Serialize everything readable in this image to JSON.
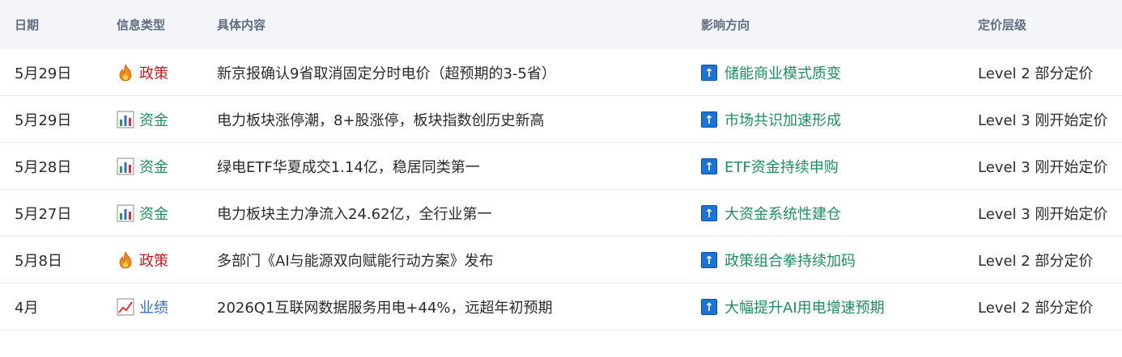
{
  "headers": {
    "date": "日期",
    "type": "信息类型",
    "content": "具体内容",
    "impact": "影响方向",
    "level": "定价层级"
  },
  "colors": {
    "policy": "#c8191c",
    "capital": "#1d8f5f",
    "earnings": "#2f6fd0",
    "impact": "#1d8f5f",
    "arrow": "#1a74d8"
  },
  "rows": [
    {
      "date": "5月29日",
      "type_icon": "fire-icon",
      "type": "政策",
      "content": "新京报确认9省取消固定分时电价（超预期的3-5省）",
      "impact_icon": "up-arrow-icon",
      "impact": "储能商业模式质变",
      "level": "Level 2 部分定价"
    },
    {
      "date": "5月29日",
      "type_icon": "bar-chart-icon",
      "type": "资金",
      "content": "电力板块涨停潮，8+股涨停，板块指数创历史新高",
      "impact_icon": "up-arrow-icon",
      "impact": "市场共识加速形成",
      "level": "Level 3 刚开始定价"
    },
    {
      "date": "5月28日",
      "type_icon": "bar-chart-icon",
      "type": "资金",
      "content": "绿电ETF华夏成交1.14亿，稳居同类第一",
      "impact_icon": "up-arrow-icon",
      "impact": "ETF资金持续申购",
      "level": "Level 3 刚开始定价"
    },
    {
      "date": "5月27日",
      "type_icon": "bar-chart-icon",
      "type": "资金",
      "content": "电力板块主力净流入24.62亿，全行业第一",
      "impact_icon": "up-arrow-icon",
      "impact": "大资金系统性建仓",
      "level": "Level 3 刚开始定价"
    },
    {
      "date": "5月8日",
      "type_icon": "fire-icon",
      "type": "政策",
      "content": "多部门《AI与能源双向赋能行动方案》发布",
      "impact_icon": "up-arrow-icon",
      "impact": "政策组合拳持续加码",
      "level": "Level 2 部分定价"
    },
    {
      "date": "4月",
      "type_icon": "trend-chart-icon",
      "type": "业绩",
      "content": "2026Q1互联网数据服务用电+44%，远超年初预期",
      "impact_icon": "up-arrow-icon",
      "impact": "大幅提升AI用电增速预期",
      "level": "Level 2 部分定价"
    }
  ]
}
